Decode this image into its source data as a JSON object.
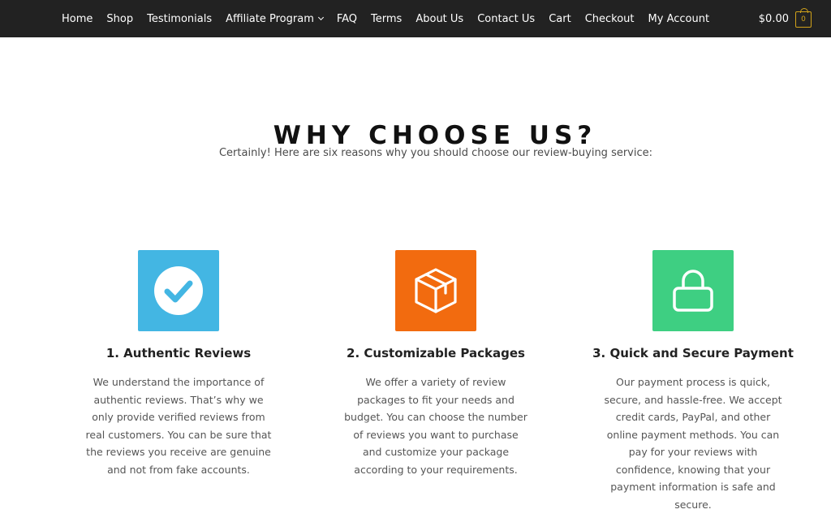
{
  "nav": {
    "items": [
      {
        "label": "Home"
      },
      {
        "label": "Shop"
      },
      {
        "label": "Testimonials"
      },
      {
        "label": "Affiliate Program",
        "has_dropdown": true
      },
      {
        "label": "FAQ"
      },
      {
        "label": "Terms"
      },
      {
        "label": "About Us"
      },
      {
        "label": "Contact Us"
      },
      {
        "label": "Cart"
      },
      {
        "label": "Checkout"
      },
      {
        "label": "My Account"
      }
    ]
  },
  "cart": {
    "total": "$0.00",
    "count": "0",
    "icon": "shopping-bag-icon",
    "accent_color": "#d1a21a"
  },
  "section": {
    "title": "WHY CHOOSE US?",
    "subtitle": "Certainly! Here are six reasons why you should choose our review-buying service:"
  },
  "features": [
    {
      "title": "1. Authentic Reviews",
      "description": "We understand the importance of authentic reviews. That’s why we only provide verified reviews from real customers. You can be sure that the reviews you receive are genuine and not from fake accounts.",
      "icon": "checkmark-circle-icon",
      "color": "#43b6e3"
    },
    {
      "title": "2. Customizable Packages",
      "description": "We offer a variety of review packages to fit your needs and budget. You can choose the number of reviews you want to purchase and customize your package according to your requirements.",
      "icon": "package-box-icon",
      "color": "#f26b0f"
    },
    {
      "title": "3. Quick and Secure Payment",
      "description": "Our payment process is quick, secure, and hassle-free. We accept credit cards, PayPal, and other online payment methods. You can pay for your reviews with confidence, knowing that your payment information is safe and secure.",
      "icon": "padlock-icon",
      "color": "#3ecf82"
    }
  ]
}
